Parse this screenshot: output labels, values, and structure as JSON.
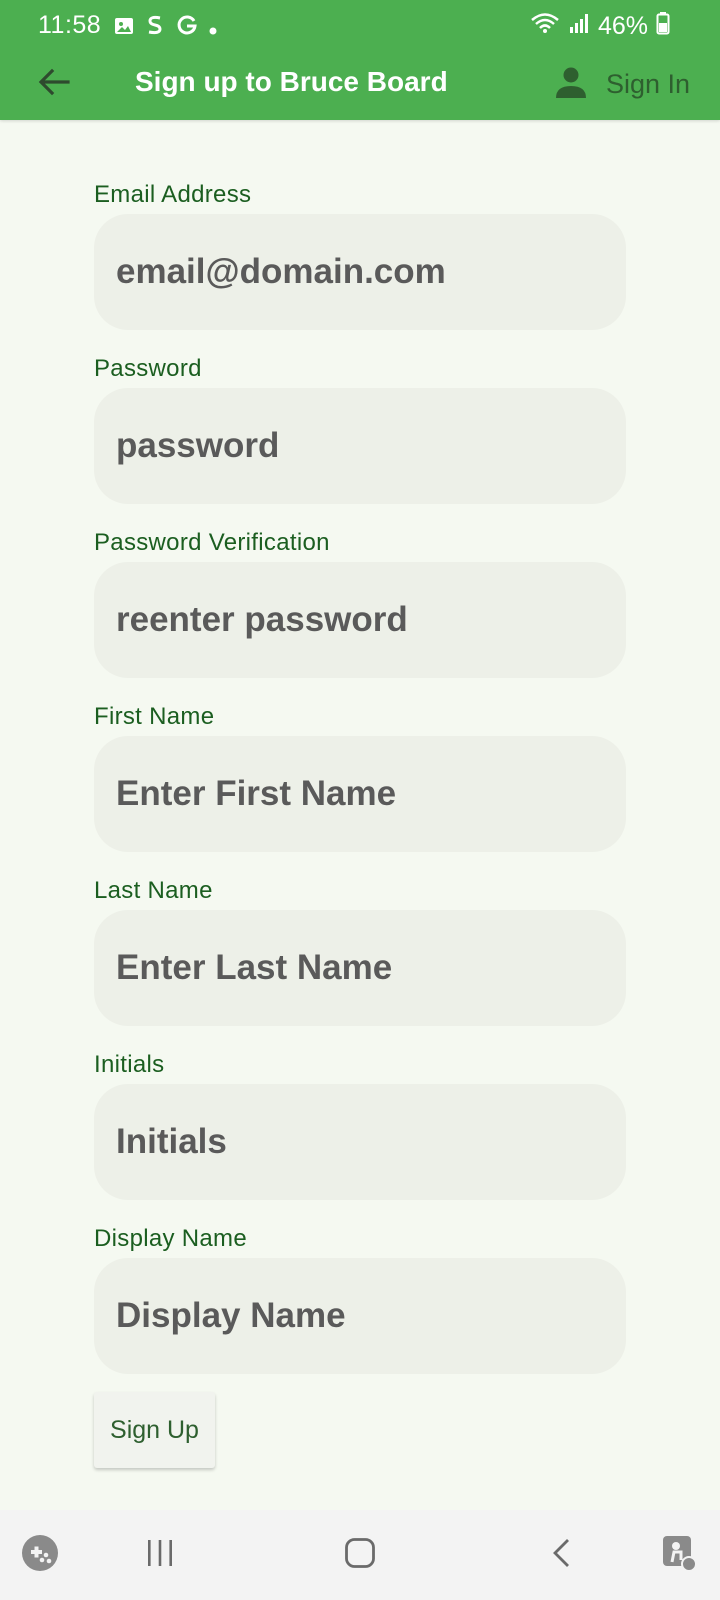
{
  "status_bar": {
    "time": "11:58",
    "battery": "46%"
  },
  "app_bar": {
    "title": "Sign up to Bruce Board",
    "sign_in_label": "Sign In",
    "color": "#4caf50"
  },
  "form": {
    "fields": [
      {
        "label": "Email Address",
        "placeholder": "email@domain.com"
      },
      {
        "label": "Password",
        "placeholder": "password"
      },
      {
        "label": "Password Verification",
        "placeholder": "reenter password"
      },
      {
        "label": "First Name",
        "placeholder": "Enter First Name"
      },
      {
        "label": "Last Name",
        "placeholder": "Enter Last Name"
      },
      {
        "label": "Initials",
        "placeholder": "Initials"
      },
      {
        "label": "Display Name",
        "placeholder": "Display Name"
      }
    ],
    "submit_label": "Sign Up"
  },
  "icons": {
    "back": "arrow-left-icon",
    "user": "person-icon",
    "nav": [
      "game-launcher-icon",
      "recent-apps-icon",
      "home-icon",
      "nav-back-icon",
      "accessibility-icon"
    ]
  }
}
